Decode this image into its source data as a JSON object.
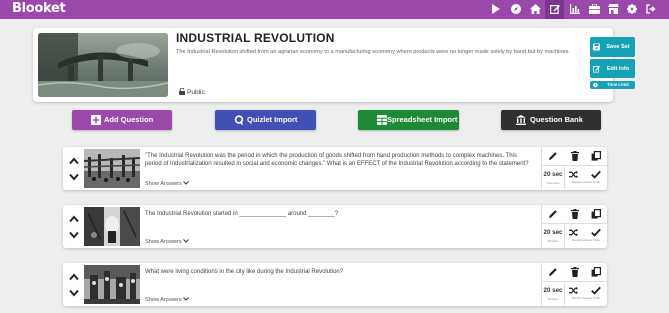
{
  "app": {
    "brand": "Blooket"
  },
  "nav": {
    "icons": [
      "play-icon",
      "compass-icon",
      "home-icon",
      "edit-icon",
      "stats-icon",
      "briefcase-icon",
      "store-icon",
      "gear-icon",
      "logout-icon"
    ],
    "active": "edit-icon"
  },
  "set": {
    "title": "INDUSTRIAL REVOLUTION",
    "description": "The Industrial Revolution shifted from an agrarian economy to a manufacturing economy where products were no longer made solely by hand but by machines.",
    "visibility": "Public",
    "save_label": "Save Set",
    "edit_info_label": "Edit Info",
    "time_limit_label": "Time Limit"
  },
  "actions": {
    "add_question": "Add Question",
    "quizlet_import": "Quizlet Import",
    "spreadsheet_import": "Spreadsheet Import",
    "question_bank": "Question Bank"
  },
  "questions": [
    {
      "text": "\"The Industrial Revolution was the period in which the production of goods shifted from hand production methods to complex machines. This period of Industrialization resulted in social and economic changes.\" What is an EFFECT of the Industrial Revolution according to the statement?",
      "show_answers": "Show Answers",
      "time": "20 sec",
      "time_sub": "Time Limit",
      "shuffle_sub": "Random Answer Order"
    },
    {
      "text": "The Industrial Revolution started in ______________ around ________?",
      "show_answers": "Show Answers",
      "time": "20 sec",
      "time_sub": "Timelimit",
      "shuffle_sub": "Random Answer Order"
    },
    {
      "text": "What were living conditions in the city like during the Industrial Revolution?",
      "show_answers": "Show Answers",
      "time": "20 sec",
      "time_sub": "Timelimit",
      "shuffle_sub": "Random Answer Order"
    }
  ],
  "colors": {
    "topbar": "#9a49aa",
    "add_question": "#9a49aa",
    "quizlet_import": "#4050b5",
    "spreadsheet_import": "#1e8a35",
    "question_bank": "#303030",
    "sidebar_button": "#17a1b4"
  }
}
